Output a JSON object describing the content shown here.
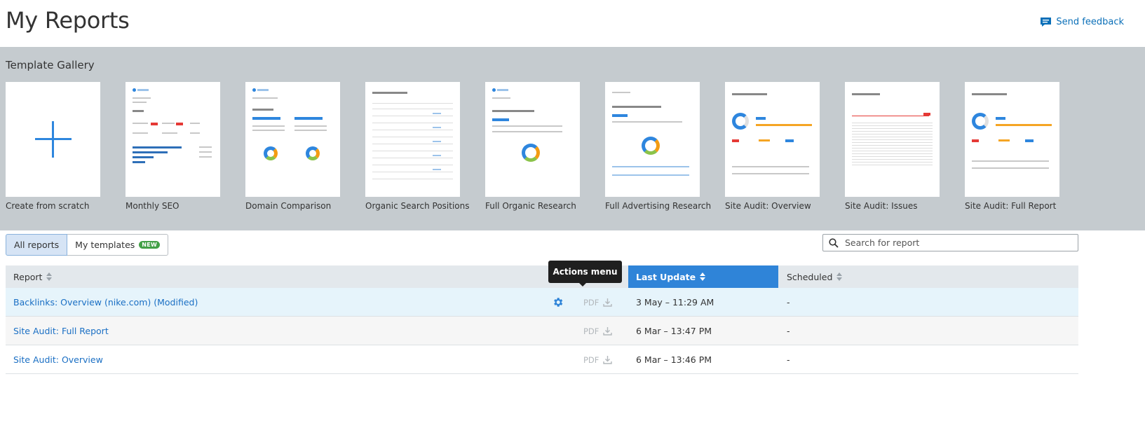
{
  "page": {
    "title": "My Reports",
    "feedback_label": "Send feedback"
  },
  "gallery": {
    "title": "Template Gallery",
    "templates": [
      {
        "label": "Create from scratch"
      },
      {
        "label": "Monthly SEO"
      },
      {
        "label": "Domain Comparison"
      },
      {
        "label": "Organic Search Positions"
      },
      {
        "label": "Full Organic Research"
      },
      {
        "label": "Full Advertising Research"
      },
      {
        "label": "Site Audit: Overview"
      },
      {
        "label": "Site Audit: Issues"
      },
      {
        "label": "Site Audit: Full Report"
      }
    ]
  },
  "tabs": {
    "all_reports": "All reports",
    "my_templates": "My templates",
    "new_badge": "NEW"
  },
  "search": {
    "placeholder": "Search for report"
  },
  "table": {
    "headers": {
      "report": "Report",
      "last_update": "Last Update",
      "scheduled": "Scheduled"
    },
    "rows": [
      {
        "name": "Backlinks: Overview (nike.com) (Modified)",
        "pdf": "PDF",
        "last_update": "3 May – 11:29 AM",
        "scheduled": "-"
      },
      {
        "name": "Site Audit: Full Report",
        "pdf": "PDF",
        "last_update": "6 Mar – 13:47 PM",
        "scheduled": "-"
      },
      {
        "name": "Site Audit: Overview",
        "pdf": "PDF",
        "last_update": "6 Mar – 13:46 PM",
        "scheduled": "-"
      }
    ]
  },
  "tooltip": {
    "text": "Actions menu"
  },
  "colors": {
    "accent": "#2f84d8",
    "link": "#1a6fc4",
    "gallery_bg": "#c5cbcf",
    "row_highlight": "#e6f4fb"
  }
}
